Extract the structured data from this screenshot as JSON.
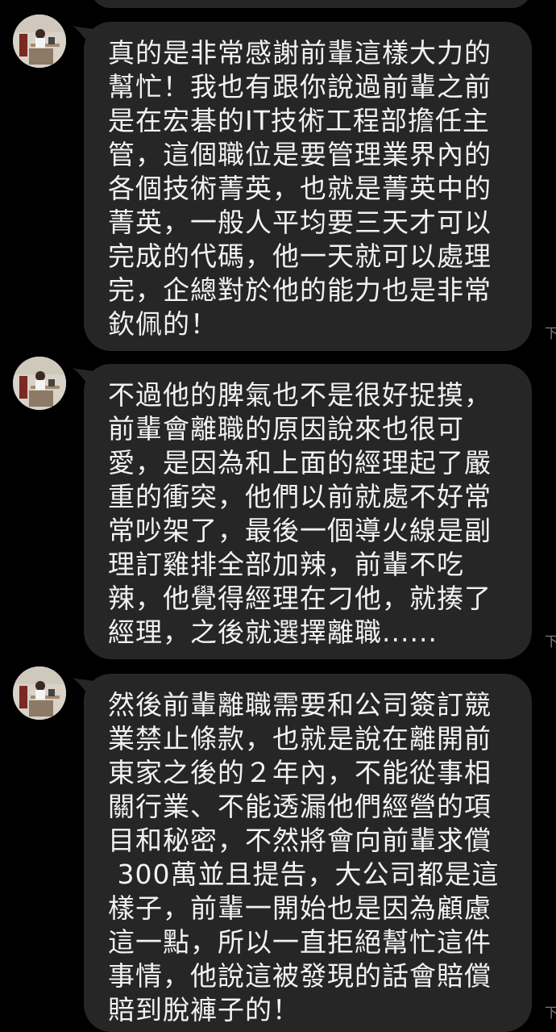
{
  "colors": {
    "background": "#000000",
    "bubble": "#262626",
    "text": "#f2f2f2",
    "timestamp": "#7a7a7a"
  },
  "messages": [
    {
      "avatar": "contact-avatar",
      "text": "真的是非常感謝前輩這樣大力的\n幫忙！我也有跟你說過前輩之前\n是在宏碁的IT技術工程部擔任主\n管，這個職位是要管理業界內的\n各個技術菁英，也就是菁英中的\n菁英，一般人平均要三天才可以\n完成的代碼，他一天就可以處理\n完，企總對於他的能力也是非常\n欽佩的！",
      "time": "下"
    },
    {
      "avatar": "contact-avatar",
      "text": "不過他的脾氣也不是很好捉摸，\n前輩會離職的原因說來也很可\n愛，是因為和上面的經理起了嚴\n重的衝突，他們以前就處不好常\n常吵架了，最後一個導火線是副\n理訂雞排全部加辣，前輩不吃\n辣，他覺得經理在刁他，就揍了\n經理，之後就選擇離職......",
      "time": "下"
    },
    {
      "avatar": "contact-avatar",
      "text": "然後前輩離職需要和公司簽訂競\n業禁止條款，也就是說在離開前\n東家之後的２年內，不能從事相\n關行業、不能透漏他們經營的項\n目和秘密，不然將會向前輩求償\n 300萬並且提告，大公司都是這\n樣子，前輩一開始也是因為顧慮\n這一點，所以一直拒絕幫忙這件\n事情，他說這被發現的話會賠償\n賠到脫褲子的！",
      "time": "下"
    }
  ]
}
